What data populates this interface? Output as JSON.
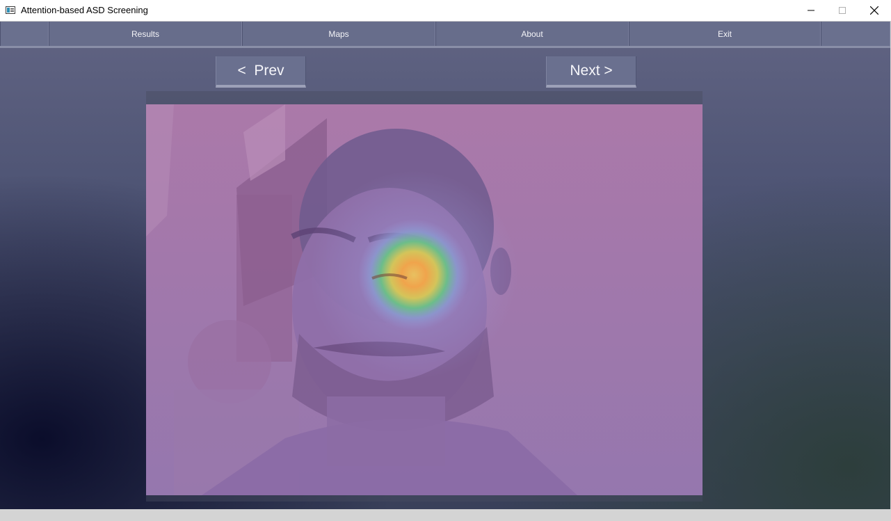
{
  "window": {
    "title": "Attention-based ASD Screening",
    "controls": {
      "minimize": "—",
      "maximize": "☐",
      "close": "✕"
    }
  },
  "menu": {
    "items": [
      {
        "label": "Results"
      },
      {
        "label": "Maps"
      },
      {
        "label": "About"
      },
      {
        "label": "Exit"
      }
    ]
  },
  "navigation": {
    "prev_label": "<  Prev",
    "next_label": "Next >"
  },
  "colors": {
    "menu_bar": "#666c8a",
    "overlay_tint": "#a877a8",
    "heatmap_hot": "#f0a040",
    "heatmap_mid": "#e0d060",
    "heatmap_cool": "#60c090"
  }
}
